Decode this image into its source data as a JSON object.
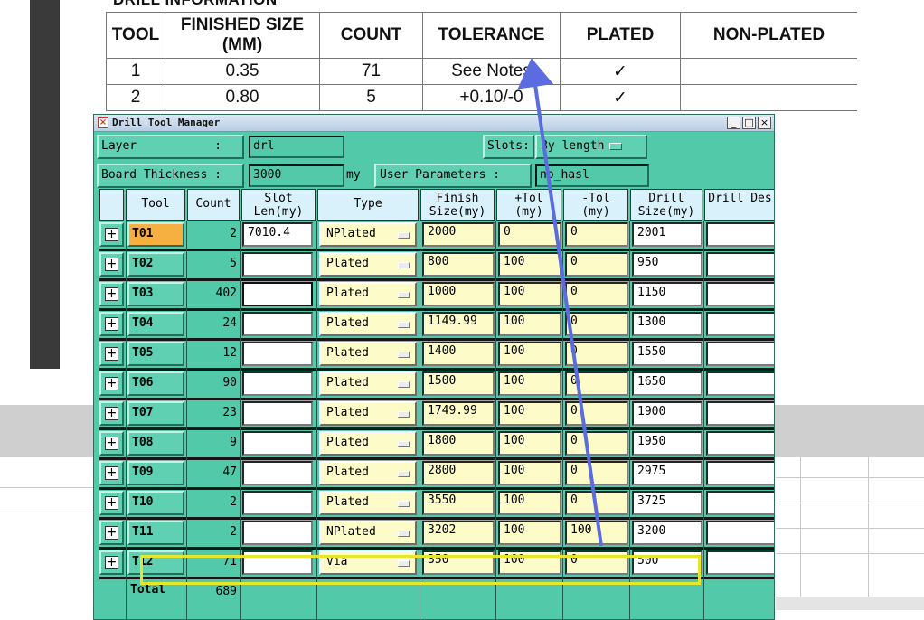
{
  "document": {
    "heading": "DRILL INFORMATION",
    "columns": [
      "TOOL",
      "FINISHED SIZE (MM)",
      "COUNT",
      "TOLERANCE",
      "PLATED",
      "NON-PLATED"
    ],
    "rows": [
      {
        "tool": "1",
        "size": "0.35",
        "count": "71",
        "tolerance": "See Notes",
        "plated": "✓",
        "non_plated": ""
      },
      {
        "tool": "2",
        "size": "0.80",
        "count": "5",
        "tolerance": "+0.10/-0",
        "plated": "✓",
        "non_plated": ""
      }
    ]
  },
  "window": {
    "title": "Drill Tool Manager",
    "min": "_",
    "max": "□",
    "close": "×"
  },
  "params": {
    "layer_label": "Layer           :",
    "layer_value": "drl",
    "slots_label": "Slots:",
    "slots_value": "By length",
    "thickness_label": "Board Thickness :",
    "thickness_value": "3000",
    "thickness_unit": "my",
    "user_params_label": "User Parameters :",
    "user_params_value": "no_hasl"
  },
  "grid": {
    "headers": [
      "",
      "Tool",
      "Count",
      "Slot Len(my)",
      "Type",
      "Finish Size(my)",
      "+Tol (my)",
      "-Tol (my)",
      "Drill Size(my)",
      "Drill Des"
    ],
    "rows": [
      {
        "tool": "T01",
        "count": "2",
        "slot": "7010.4",
        "type": "NPlated",
        "finish": "2000",
        "ptol": "0",
        "mtol": "0",
        "drill": "2001",
        "des": ""
      },
      {
        "tool": "T02",
        "count": "5",
        "slot": "",
        "type": "Plated",
        "finish": "800",
        "ptol": "100",
        "mtol": "0",
        "drill": "950",
        "des": ""
      },
      {
        "tool": "T03",
        "count": "402",
        "slot": "",
        "type": "Plated",
        "finish": "1000",
        "ptol": "100",
        "mtol": "0",
        "drill": "1150",
        "des": ""
      },
      {
        "tool": "T04",
        "count": "24",
        "slot": "",
        "type": "Plated",
        "finish": "1149.99",
        "ptol": "100",
        "mtol": "0",
        "drill": "1300",
        "des": ""
      },
      {
        "tool": "T05",
        "count": "12",
        "slot": "",
        "type": "Plated",
        "finish": "1400",
        "ptol": "100",
        "mtol": "0",
        "drill": "1550",
        "des": ""
      },
      {
        "tool": "T06",
        "count": "90",
        "slot": "",
        "type": "Plated",
        "finish": "1500",
        "ptol": "100",
        "mtol": "0",
        "drill": "1650",
        "des": ""
      },
      {
        "tool": "T07",
        "count": "23",
        "slot": "",
        "type": "Plated",
        "finish": "1749.99",
        "ptol": "100",
        "mtol": "0",
        "drill": "1900",
        "des": ""
      },
      {
        "tool": "T08",
        "count": "9",
        "slot": "",
        "type": "Plated",
        "finish": "1800",
        "ptol": "100",
        "mtol": "0",
        "drill": "1950",
        "des": ""
      },
      {
        "tool": "T09",
        "count": "47",
        "slot": "",
        "type": "Plated",
        "finish": "2800",
        "ptol": "100",
        "mtol": "0",
        "drill": "2975",
        "des": ""
      },
      {
        "tool": "T10",
        "count": "2",
        "slot": "",
        "type": "Plated",
        "finish": "3550",
        "ptol": "100",
        "mtol": "0",
        "drill": "3725",
        "des": ""
      },
      {
        "tool": "T11",
        "count": "2",
        "slot": "",
        "type": "NPlated",
        "finish": "3202",
        "ptol": "100",
        "mtol": "100",
        "drill": "3200",
        "des": ""
      },
      {
        "tool": "T12",
        "count": "71",
        "slot": "",
        "type": "Via",
        "finish": "350",
        "ptol": "100",
        "mtol": "0",
        "drill": "500",
        "des": ""
      }
    ],
    "total_label": "Total",
    "total_count": "689"
  },
  "colors": {
    "panel": "#52c9a8",
    "selected_tool": "#f5b041",
    "highlight_box": "#e6e62a",
    "arrow": "#5b6be0"
  }
}
